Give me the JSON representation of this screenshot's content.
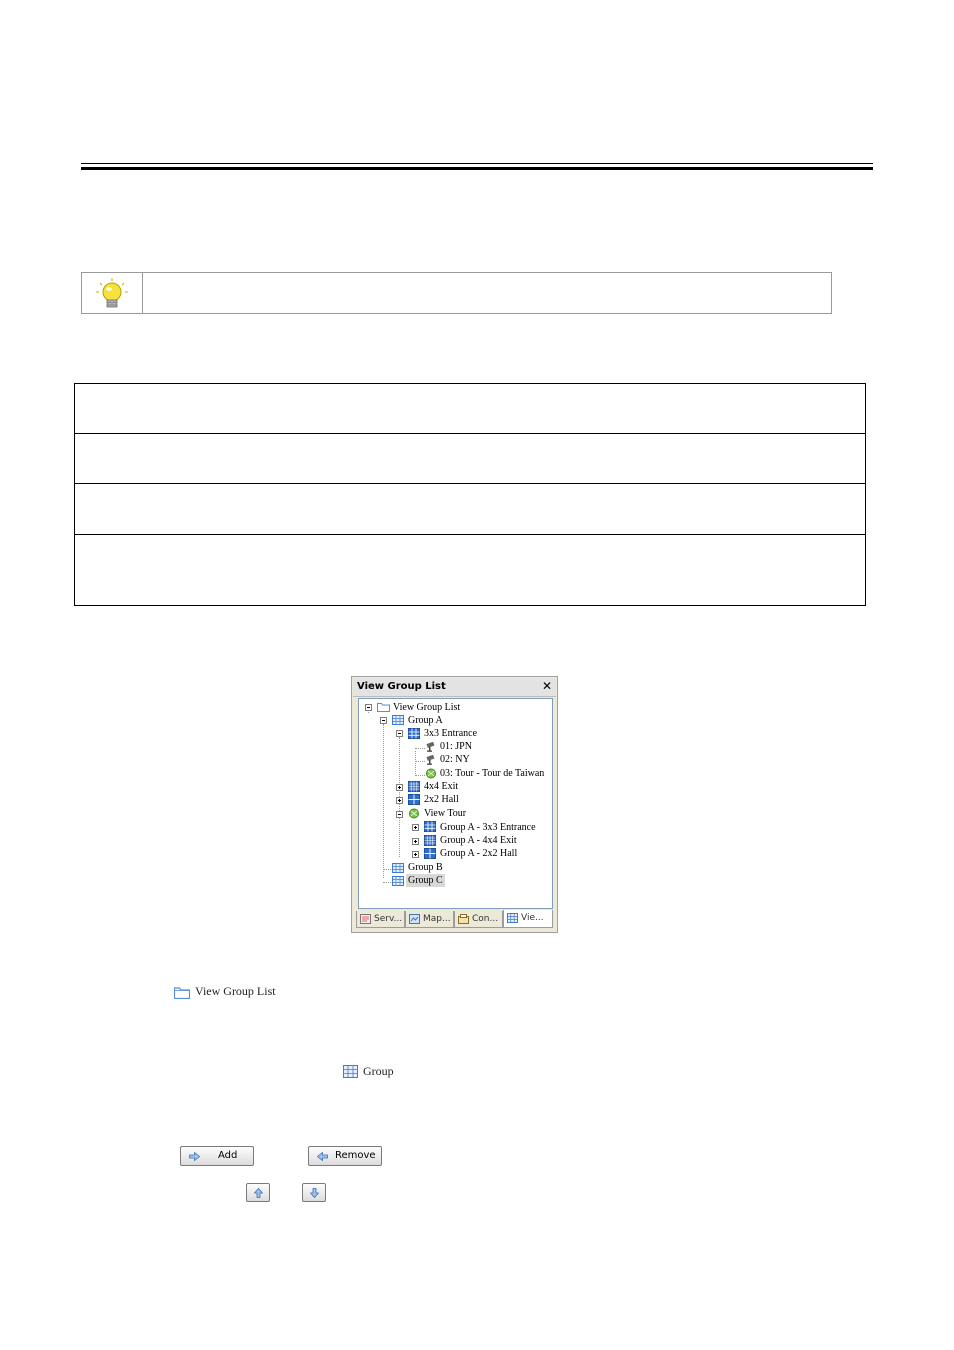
{
  "window": {
    "title": "View Group List",
    "close_glyph": "✕"
  },
  "tree": {
    "root": "View Group List",
    "group_a": "Group A",
    "layout_3x3": "3x3 Entrance",
    "cam_01": "01: JPN",
    "cam_02": "02: NY",
    "tour_03": "03: Tour - Tour de Taiwan",
    "layout_4x4": "4x4 Exit",
    "layout_2x2": "2x2 Hall",
    "view_tour": "View Tour",
    "tour_item_1": "Group A - 3x3 Entrance",
    "tour_item_2": "Group A - 4x4 Exit",
    "tour_item_3": "Group A - 2x2 Hall",
    "group_b": "Group B",
    "group_c": "Group C"
  },
  "tabs": [
    {
      "label": "Serv...",
      "icon": "server-icon"
    },
    {
      "label": "Map...",
      "icon": "map-icon"
    },
    {
      "label": "Con...",
      "icon": "console-icon"
    },
    {
      "label": "Vie...",
      "icon": "view-icon"
    }
  ],
  "legend": {
    "view_group_list": "View Group List",
    "group": "Group"
  },
  "buttons": {
    "add": "Add",
    "remove": "Remove"
  },
  "colors": {
    "folder": "#5a8fd8",
    "grid_icon": "#3d7bd6",
    "bulb": "#f5e23c"
  }
}
